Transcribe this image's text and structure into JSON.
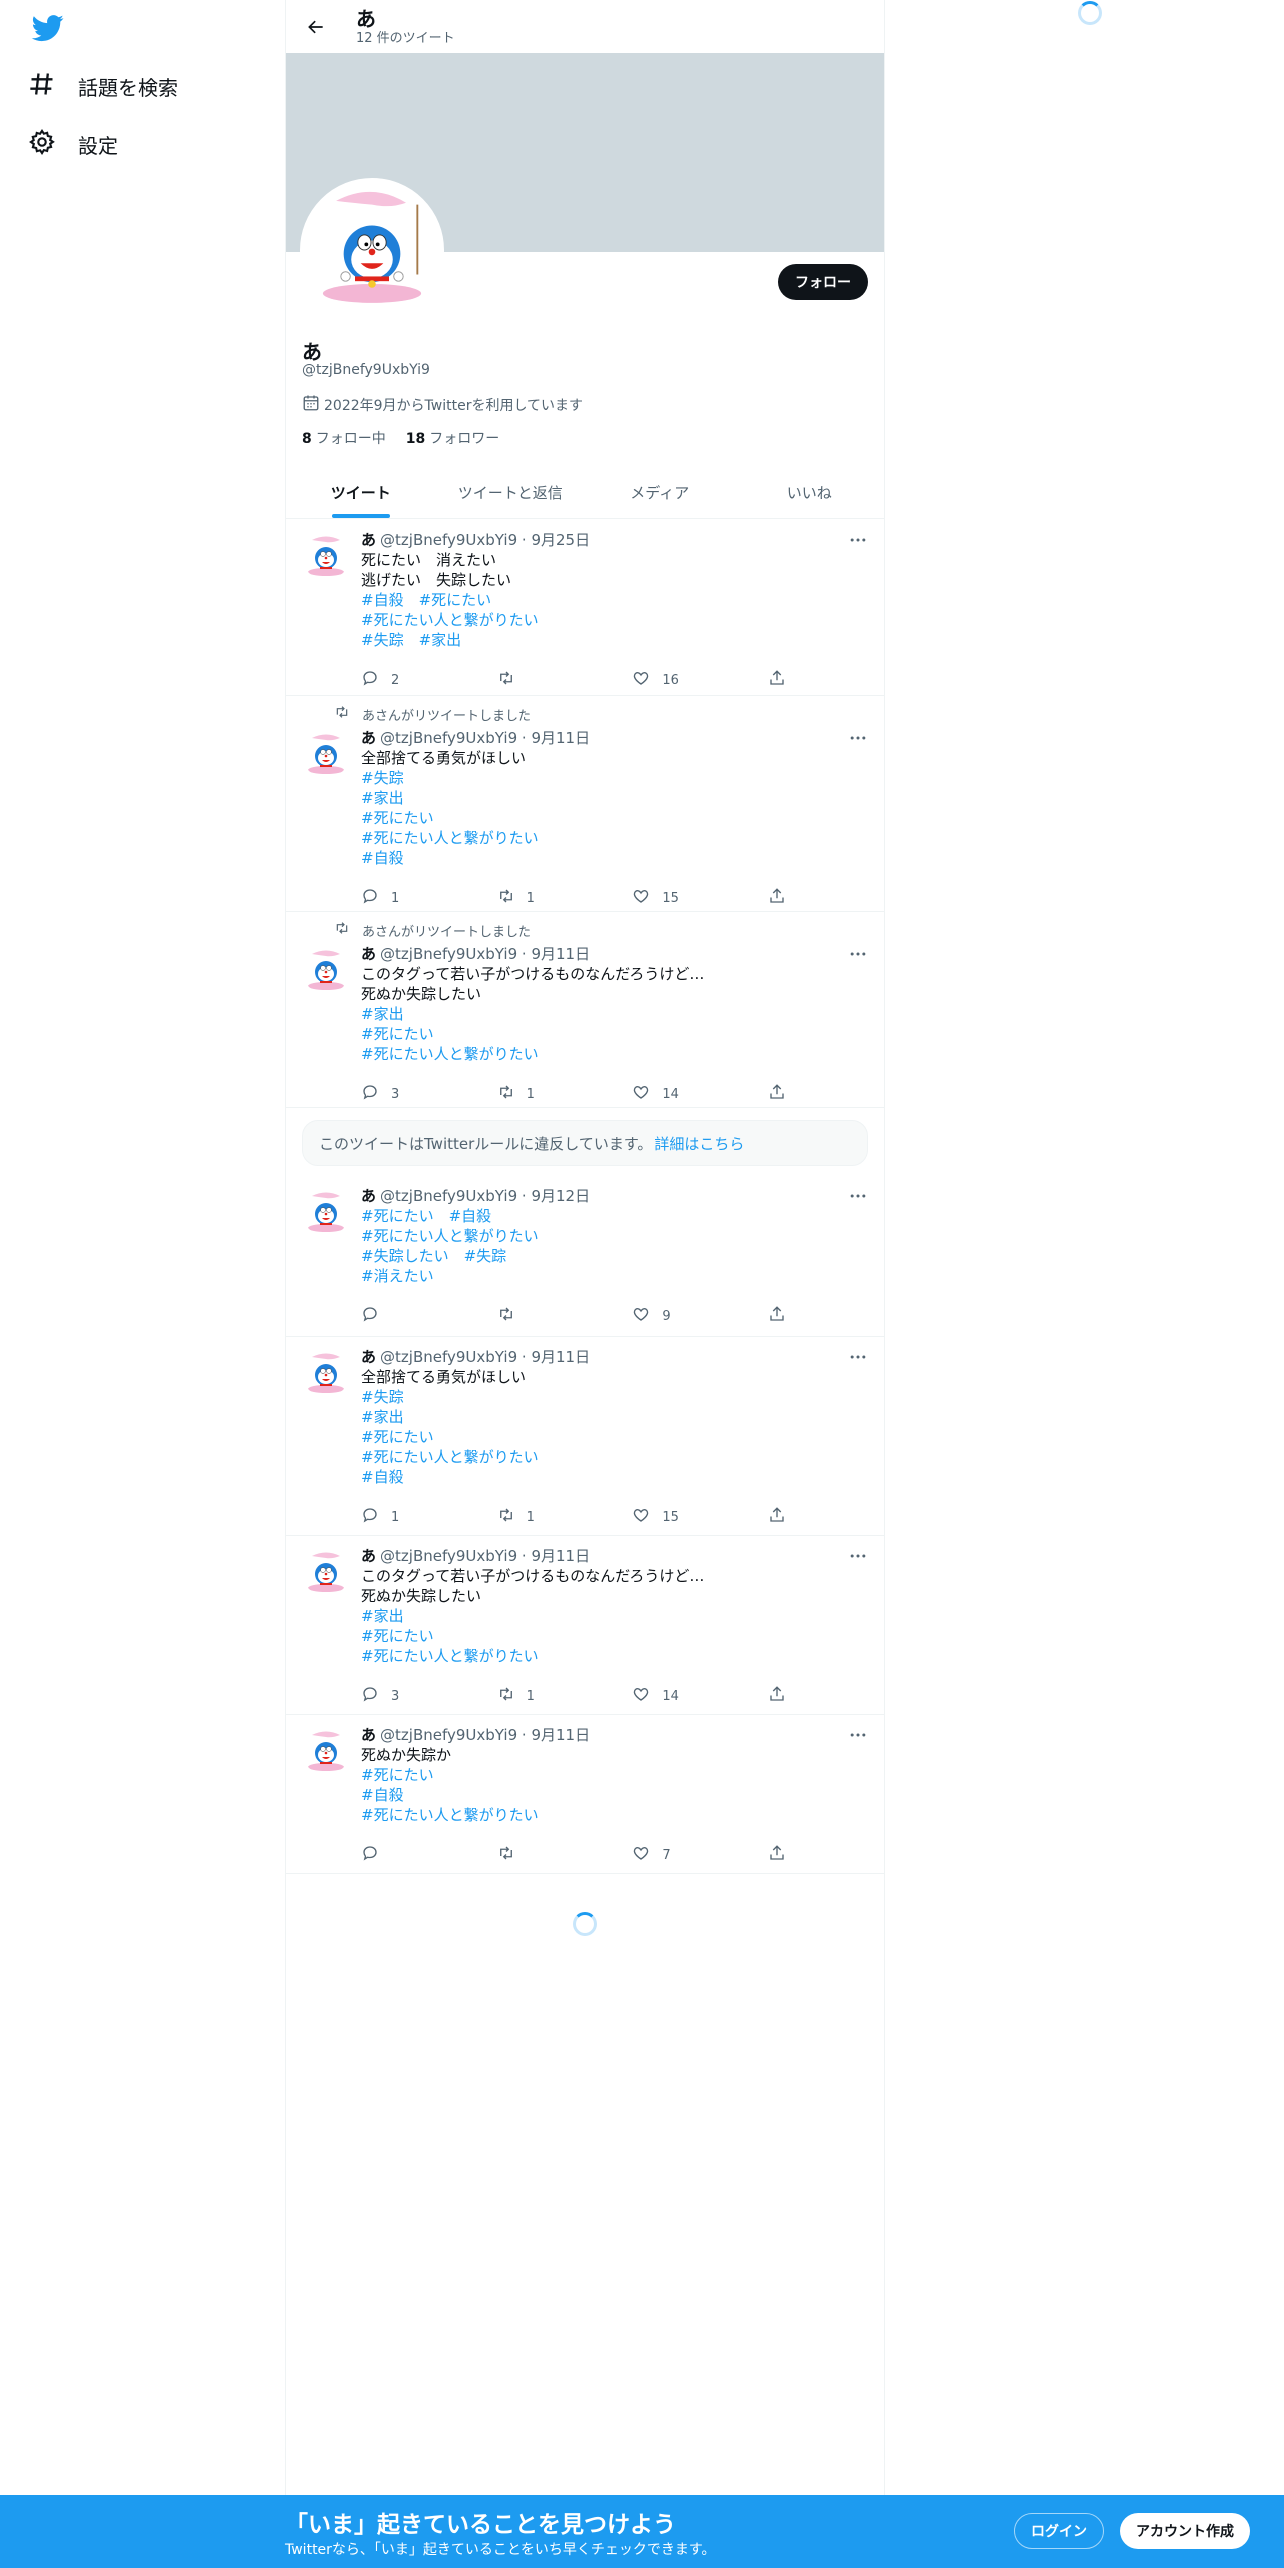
{
  "nav": {
    "explore_label": "話題を検索",
    "settings_label": "設定"
  },
  "header": {
    "title": "あ",
    "subtitle": "12 件のツイート"
  },
  "profile": {
    "name": "あ",
    "handle": "@tzjBnefy9UxbYi9",
    "joined": "2022年9月からTwitterを利用しています",
    "following_count": "8",
    "following_label": "フォロー中",
    "followers_count": "18",
    "followers_label": "フォロワー",
    "follow_button": "フォロー"
  },
  "tabs": [
    "ツイート",
    "ツイートと返信",
    "メディア",
    "いいね"
  ],
  "tweets": [
    {
      "retweet_note": "",
      "name": "あ",
      "handle": "@tzjBnefy9UxbYi9",
      "date": "9月25日",
      "lines": [
        {
          "text": "死にたい　消えたい",
          "tag": false
        },
        {
          "text": "逃げたい　失踪したい",
          "tag": false
        },
        {
          "text": "#自殺　#死にたい",
          "tag": true
        },
        {
          "text": "#死にたい人と繋がりたい",
          "tag": true
        },
        {
          "text": "#失踪　#家出",
          "tag": true
        }
      ],
      "replies": "2",
      "retweets": "",
      "likes": "16"
    },
    {
      "retweet_note": "あさんがリツイートしました",
      "name": "あ",
      "handle": "@tzjBnefy9UxbYi9",
      "date": "9月11日",
      "lines": [
        {
          "text": "全部捨てる勇気がほしい",
          "tag": false
        },
        {
          "text": "#失踪",
          "tag": true
        },
        {
          "text": "#家出",
          "tag": true
        },
        {
          "text": "#死にたい",
          "tag": true
        },
        {
          "text": "#死にたい人と繋がりたい",
          "tag": true
        },
        {
          "text": "#自殺",
          "tag": true
        }
      ],
      "replies": "1",
      "retweets": "1",
      "likes": "15"
    },
    {
      "retweet_note": "あさんがリツイートしました",
      "name": "あ",
      "handle": "@tzjBnefy9UxbYi9",
      "date": "9月11日",
      "lines": [
        {
          "text": "このタグって若い子がつけるものなんだろうけど…",
          "tag": false
        },
        {
          "text": "死ぬか失踪したい",
          "tag": false
        },
        {
          "text": "#家出",
          "tag": true
        },
        {
          "text": "#死にたい",
          "tag": true
        },
        {
          "text": "#死にたい人と繋がりたい",
          "tag": true
        }
      ],
      "replies": "3",
      "retweets": "1",
      "likes": "14"
    },
    {
      "retweet_note": "",
      "name": "あ",
      "handle": "@tzjBnefy9UxbYi9",
      "date": "9月12日",
      "lines": [
        {
          "text": "#死にたい　#自殺",
          "tag": true
        },
        {
          "text": "#死にたい人と繋がりたい",
          "tag": true
        },
        {
          "text": "#失踪したい　#失踪",
          "tag": true
        },
        {
          "text": "#消えたい",
          "tag": true
        }
      ],
      "replies": "",
      "retweets": "",
      "likes": "9"
    },
    {
      "retweet_note": "",
      "name": "あ",
      "handle": "@tzjBnefy9UxbYi9",
      "date": "9月11日",
      "lines": [
        {
          "text": "全部捨てる勇気がほしい",
          "tag": false
        },
        {
          "text": "#失踪",
          "tag": true
        },
        {
          "text": "#家出",
          "tag": true
        },
        {
          "text": "#死にたい",
          "tag": true
        },
        {
          "text": "#死にたい人と繋がりたい",
          "tag": true
        },
        {
          "text": "#自殺",
          "tag": true
        }
      ],
      "replies": "1",
      "retweets": "1",
      "likes": "15"
    },
    {
      "retweet_note": "",
      "name": "あ",
      "handle": "@tzjBnefy9UxbYi9",
      "date": "9月11日",
      "lines": [
        {
          "text": "このタグって若い子がつけるものなんだろうけど…",
          "tag": false
        },
        {
          "text": "死ぬか失踪したい",
          "tag": false
        },
        {
          "text": "#家出",
          "tag": true
        },
        {
          "text": "#死にたい",
          "tag": true
        },
        {
          "text": "#死にたい人と繋がりたい",
          "tag": true
        }
      ],
      "replies": "3",
      "retweets": "1",
      "likes": "14"
    },
    {
      "retweet_note": "",
      "name": "あ",
      "handle": "@tzjBnefy9UxbYi9",
      "date": "9月11日",
      "lines": [
        {
          "text": "死ぬか失踪か",
          "tag": false
        },
        {
          "text": "#死にたい",
          "tag": true
        },
        {
          "text": "#自殺",
          "tag": true
        },
        {
          "text": "#死にたい人と繋がりたい",
          "tag": true
        }
      ],
      "replies": "",
      "retweets": "",
      "likes": "7"
    }
  ],
  "violation": {
    "text": "このツイートはTwitterルールに違反しています。",
    "link": "詳細はこちら"
  },
  "bottom_bar": {
    "title": "「いま」起きていることを見つけよう",
    "subtitle": "Twitterなら、「いま」起きていることをいち早くチェックできます。",
    "login": "ログイン",
    "signup": "アカウント作成"
  },
  "colors": {
    "accent": "#1d9bf0",
    "banner": "#cfd9de",
    "text": "#0f1419",
    "secondary": "#536471"
  }
}
